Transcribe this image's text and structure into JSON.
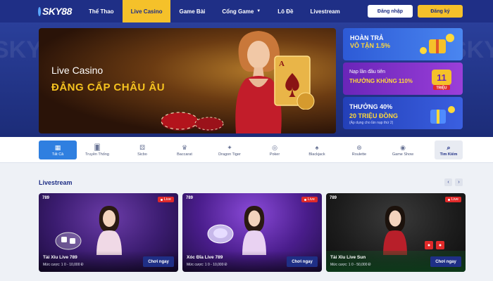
{
  "header": {
    "logo_text": "SKY88",
    "nav": [
      {
        "label": "Thể Thao"
      },
      {
        "label": "Live Casino"
      },
      {
        "label": "Game Bài"
      },
      {
        "label": "Cổng Game"
      },
      {
        "label": "Lô Đề"
      },
      {
        "label": "Livestream"
      }
    ],
    "active_nav": "Live Casino",
    "login_label": "Đăng nhập",
    "register_label": "Đăng ký"
  },
  "hero": {
    "bg_text": "SKY",
    "main": {
      "title": "Live Casino",
      "subtitle": "ĐẲNG CẤP CHÂU ÂU"
    },
    "promos": [
      {
        "line1": "HOÀN TRẢ",
        "line2": "VÔ TẬN 1.5%"
      },
      {
        "line1": "Nạp lần đầu tiên",
        "line2": "THƯỞNG KHỦNG 110%",
        "badge_number": "11",
        "badge_word": "TRIỆU"
      },
      {
        "line1": "THƯỞNG 40%",
        "line2": "20 TRIỆU ĐỒNG",
        "line3": "(Áp dụng cho lần nạp thứ 2)"
      }
    ]
  },
  "categories": [
    {
      "label": "Tất Cả",
      "icon": "grid-icon"
    },
    {
      "label": "Truyền Thống",
      "icon": "cards-icon"
    },
    {
      "label": "Sicbo",
      "icon": "dice-icon"
    },
    {
      "label": "Baccarat",
      "icon": "baccarat-icon"
    },
    {
      "label": "Dragon Tiger",
      "icon": "dragon-icon"
    },
    {
      "label": "Poker",
      "icon": "poker-chip-icon"
    },
    {
      "label": "Blackjack",
      "icon": "blackjack-icon"
    },
    {
      "label": "Roulette",
      "icon": "roulette-icon"
    },
    {
      "label": "Game Show",
      "icon": "gameshow-icon"
    },
    {
      "label": "Tìm Kiếm",
      "icon": "search-icon"
    }
  ],
  "livestream": {
    "title": "Livestream",
    "prev": "‹",
    "next": "›",
    "cards": [
      {
        "brand": "789",
        "badge": "Live",
        "name": "Tài Xỉu Live 789",
        "bet": "Mức cược: 1 0 - 10,000 Đ",
        "play": "Chơi ngay"
      },
      {
        "brand": "789",
        "badge": "Live",
        "name": "Xóc Đĩa Live 789",
        "bet": "Mức cược: 1 0 - 10,000 Đ",
        "play": "Chơi ngay"
      },
      {
        "brand": "789",
        "badge": "Live",
        "name": "Tài Xỉu Live Sun",
        "bet": "Mức cược: 1 0 - 50,000 Đ",
        "play": "Chơi ngay"
      }
    ]
  },
  "colors": {
    "primary": "#1f2f86",
    "accent": "#f5c12a",
    "active_tab": "#2f7fe0",
    "live_red": "#e02a2a"
  }
}
